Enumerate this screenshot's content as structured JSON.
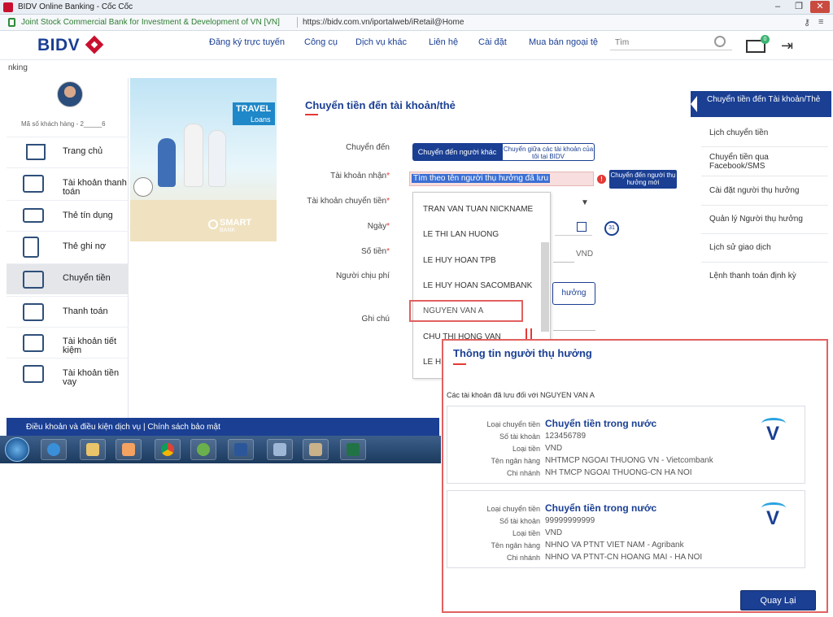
{
  "window": {
    "title": "BIDV Online Banking - Cốc Cốc",
    "cert_owner": "Joint Stock Commercial Bank for Investment & Development of VN [VN]",
    "url": "https://bidv.com.vn/iportalweb/iRetail@Home",
    "controls": [
      "–",
      "❐",
      "✕"
    ]
  },
  "header": {
    "logo": "BIDV",
    "nav": [
      "Đăng ký trực tuyến",
      "Công cụ",
      "Dịch vụ khác",
      "Liên hệ",
      "Cài đặt",
      "Mua bán ngoại tệ"
    ],
    "search_placeholder": "Tìm",
    "notification_count": "0"
  },
  "breadcrumb": "nking",
  "sidebar": {
    "customer_id": "Mã số khách hàng - 2_____6",
    "items": [
      {
        "label": "Trang chủ",
        "icon": "home-icon"
      },
      {
        "label": "Tài khoản thanh toán",
        "icon": "account-card-icon"
      },
      {
        "label": "Thẻ tín dụng",
        "icon": "credit-card-icon"
      },
      {
        "label": "Thẻ ghi nợ",
        "icon": "debit-card-icon"
      },
      {
        "label": "Chuyển tiền",
        "icon": "transfer-icon"
      },
      {
        "label": "Thanh toán",
        "icon": "payment-icon"
      },
      {
        "label": "Tài khoản tiết kiệm",
        "icon": "savings-icon"
      },
      {
        "label": "Tài khoản tiền vay",
        "icon": "loan-icon"
      }
    ]
  },
  "banner": {
    "travel": "TRAVEL",
    "loans": "Loans",
    "smart": "SMART",
    "bank": "BANK"
  },
  "form": {
    "title": "Chuyển tiền đến tài khoản/thẻ",
    "labels": {
      "transfer_to": "Chuyển đến",
      "receiver_account": "Tài khoản nhận",
      "source_account": "Tài khoản chuyển tiền",
      "date": "Ngày",
      "amount": "Số tiền",
      "fee_payer": "Người chịu phí",
      "note": "Ghi chú"
    },
    "toggle_others": "Chuyển đến người khác",
    "toggle_own": "Chuyển giữa các tài khoản của tôi tại BIDV",
    "search_value": "Tìm theo tên người thụ hưởng đã lưu",
    "new_beneficiary_button": "Chuyển đến người thụ hưởng mới",
    "currency": "VND",
    "fee_option": "hưởng",
    "required_mark": "*"
  },
  "dropdown": {
    "items": [
      "TRAN VAN TUAN NICKNAME",
      "LE THI LAN HUONG",
      "LE HUY HOAN TPB",
      "LE HUY HOAN SACOMBANK",
      "NGUYEN VAN A",
      "CHU THI HONG VAN",
      "LE H"
    ]
  },
  "right_menu": {
    "active": "Chuyển tiền đến Tài khoản/Thẻ",
    "items": [
      "Lịch chuyển tiền",
      "Chuyển tiền qua Facebook/SMS",
      "Cài đặt người thụ hưởng",
      "Quản lý Người thụ hưởng",
      "Lịch sử giao dịch",
      "Lệnh thanh toán định kỳ"
    ]
  },
  "footer": {
    "terms": "Điều khoản và điều kiện dịch vụ | Chính sách bảo mật"
  },
  "info_panel": {
    "title": "Thông tin người thụ hưởng",
    "subtitle": "Các tài khoản đã lưu đối với NGUYEN VAN A",
    "field_labels": [
      "Loại chuyển tiền",
      "Số tài khoản",
      "Loại tiền",
      "Tên ngân hàng",
      "Chi nhánh"
    ],
    "accounts": [
      {
        "transfer_type": "Chuyển tiền trong nước",
        "account_number": "123456789",
        "currency": "VND",
        "bank_name": "NHTMCP NGOAI THUONG VN - Vietcombank",
        "branch": "NH TMCP NGOAI THUONG-CN HA NOI"
      },
      {
        "transfer_type": "Chuyển tiền trong nước",
        "account_number": "99999999999",
        "currency": "VND",
        "bank_name": "NHNO VA PTNT VIET NAM - Agribank",
        "branch": "NHNO VA PTNT-CN HOANG MAI - HA NOI"
      }
    ],
    "bank_logo": "V",
    "back_button": "Quay Lại"
  }
}
